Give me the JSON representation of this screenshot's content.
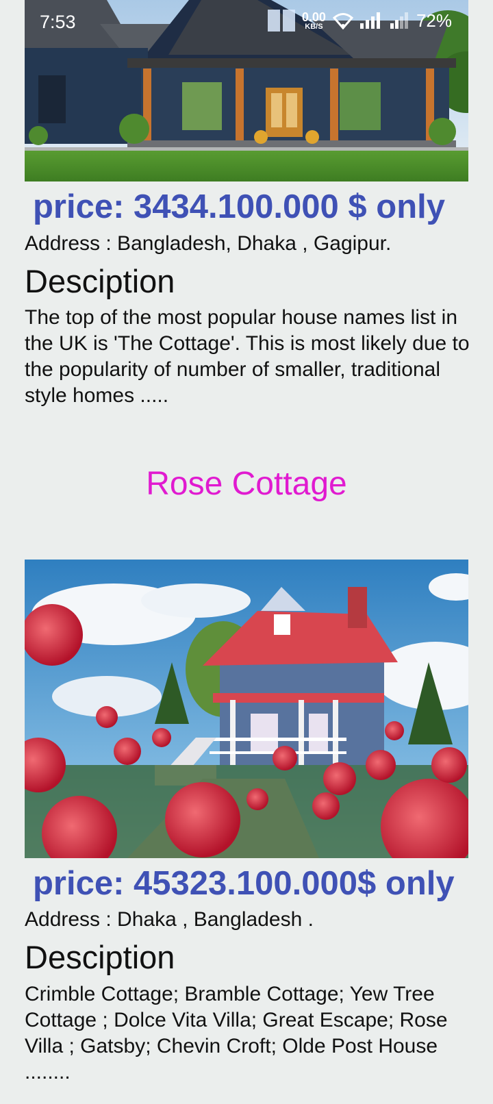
{
  "status_bar": {
    "time": "7:53",
    "speed_value": "0.00",
    "speed_unit": "KB/S",
    "battery": "72%"
  },
  "listings": [
    {
      "price": "price: 3434.100.000 $ only",
      "address": "Address : Bangladesh, Dhaka , Gagipur.",
      "description_heading": "Desciption",
      "description": "The top of the most popular house names list in the UK is 'The Cottage'. This is most likely due to the popularity of number of smaller, traditional style homes ....."
    },
    {
      "title": "Rose Cottage",
      "price": "price: 45323.100.000$ only",
      "address": "Address : Dhaka , Bangladesh .",
      "description_heading": "Desciption",
      "description": "Crimble Cottage; Bramble Cottage; Yew Tree Cottage ; Dolce Vita Villa; Great Escape; Rose Villa ; Gatsby; Chevin Croft; Olde Post House ........"
    }
  ],
  "colors": {
    "price": "#3f51b5",
    "title": "#e01ad0",
    "background": "#ebeeed"
  }
}
